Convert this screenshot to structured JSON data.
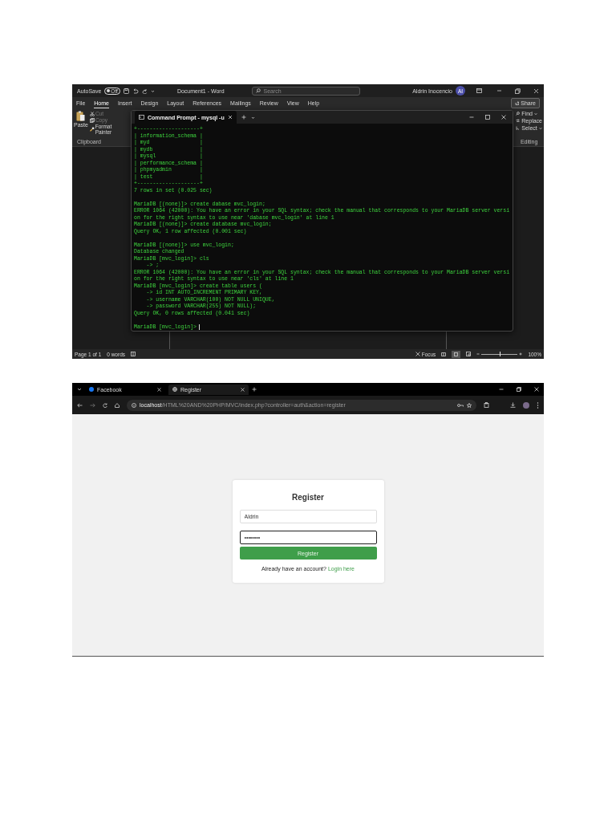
{
  "word_window": {
    "autosave": {
      "label": "AutoSave",
      "state_label": "Off",
      "on": false
    },
    "title": "Document1  -  Word",
    "search": {
      "placeholder": "Search"
    },
    "user_name": "Aldrin Inocencio",
    "avatar": "AI",
    "tabs": [
      {
        "label": "File",
        "selected": false
      },
      {
        "label": "Home",
        "selected": true
      },
      {
        "label": "Insert",
        "selected": false
      },
      {
        "label": "Design",
        "selected": false
      },
      {
        "label": "Layout",
        "selected": false
      },
      {
        "label": "References",
        "selected": false
      },
      {
        "label": "Mailings",
        "selected": false
      },
      {
        "label": "Review",
        "selected": false
      },
      {
        "label": "View",
        "selected": false
      },
      {
        "label": "Help",
        "selected": false
      }
    ],
    "share": "Share",
    "clipboard": {
      "paste": "Paste",
      "cut": "Cut",
      "copy": "Copy",
      "format_painter": "Format Painter",
      "group": "Clipboard"
    },
    "editing": {
      "find": "Find",
      "replace": "Replace",
      "select": "Select",
      "group": "Editing"
    },
    "status_bar": {
      "page": "Page 1 of 1",
      "words": "0 words",
      "focus": "Focus",
      "zoom": "100%",
      "level": 0.5
    }
  },
  "terminal": {
    "tab": "Command Prompt - mysql -u",
    "blocks": [
      [
        "+--------------------+",
        "| information_schema |",
        "| myd                |",
        "| mydb               |",
        "| mysql              |",
        "| performance_schema |",
        "| phpmyadmin         |",
        "| test               |",
        "+--------------------+",
        "7 rows in set (0.025 sec)"
      ],
      [
        "MariaDB [(none)]> create dabase mvc_login;",
        "ERROR 1064 (42000): You have an error in your SQL syntax; check the manual that corresponds to your MariaDB server versi",
        "on for the right syntax to use near 'dabase mvc_login' at line 1",
        "MariaDB [(none)]> create database mvc_login;",
        "Query OK, 1 row affected (0.001 sec)"
      ],
      [
        "MariaDB [(none)]> use mvc_login;",
        "Database changed",
        "MariaDB [mvc_login]> cls",
        "    -> ;",
        "ERROR 1064 (42000): You have an error in your SQL syntax; check the manual that corresponds to your MariaDB server versi",
        "on for the right syntax to use near 'cls' at line 1",
        "MariaDB [mvc_login]> create table users (",
        "    -> id INT AUTO_INCREMENT PRIMARY KEY,",
        "    -> username VARCHAR(100) NOT NULL UNIQUE,",
        "    -> password VARCHAR(255) NOT NULL);",
        "Query OK, 0 rows affected (0.041 sec)"
      ],
      [
        "MariaDB [mvc_login]>"
      ]
    ]
  },
  "browser": {
    "tabs": [
      {
        "label": "Facebook",
        "kind": "facebook",
        "selected": false
      },
      {
        "label": "Register",
        "kind": "globe",
        "selected": true
      }
    ],
    "address": {
      "host": "localhost",
      "path": "/HTML%20AND%20PHP/MVC/index.php?controller=auth&action=register"
    },
    "form": {
      "title": "Register",
      "username": "Aldrin",
      "password": "••••••••",
      "button": "Register",
      "prompt": "Already have an account?",
      "link": "Login here"
    }
  }
}
